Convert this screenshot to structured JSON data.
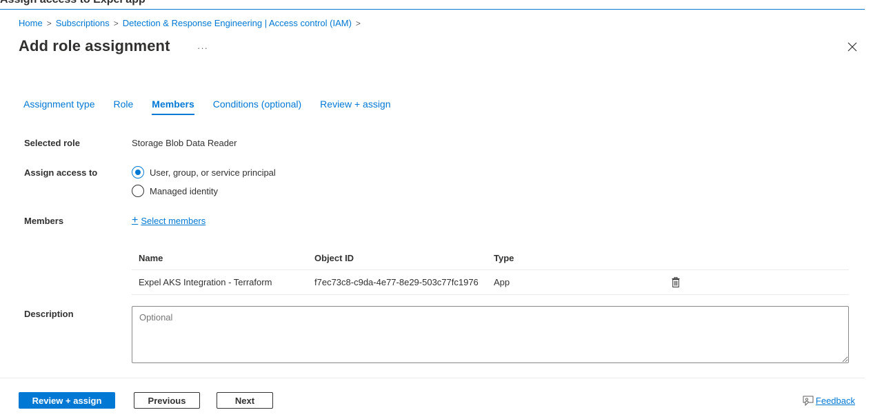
{
  "window": {
    "top_title": "Assign access to Expel app"
  },
  "breadcrumb": {
    "items": [
      "Home",
      "Subscriptions",
      "Detection & Response Engineering | Access control (IAM)"
    ]
  },
  "page": {
    "title": "Add role assignment",
    "more": "···"
  },
  "tabs": [
    {
      "label": "Assignment type",
      "active": false
    },
    {
      "label": "Role",
      "active": false
    },
    {
      "label": "Members",
      "active": true
    },
    {
      "label": "Conditions (optional)",
      "active": false
    },
    {
      "label": "Review + assign",
      "active": false
    }
  ],
  "form": {
    "selected_role_label": "Selected role",
    "selected_role_value": "Storage Blob Data Reader",
    "assign_access_label": "Assign access to",
    "assign_options": [
      {
        "label": "User, group, or service principal",
        "selected": true
      },
      {
        "label": "Managed identity",
        "selected": false
      }
    ],
    "members_label": "Members",
    "select_members": "Select members",
    "description_label": "Description",
    "description_placeholder": "Optional"
  },
  "members_table": {
    "columns": [
      "Name",
      "Object ID",
      "Type"
    ],
    "rows": [
      {
        "name": "Expel AKS Integration - Terraform",
        "object_id": "f7ec73c8-c9da-4e77-8e29-503c77fc1976",
        "type": "App"
      }
    ]
  },
  "footer": {
    "review_assign": "Review + assign",
    "previous": "Previous",
    "next": "Next",
    "feedback": "Feedback"
  },
  "colors": {
    "accent": "#0078d4",
    "text": "#323130",
    "border": "#8a8886"
  }
}
